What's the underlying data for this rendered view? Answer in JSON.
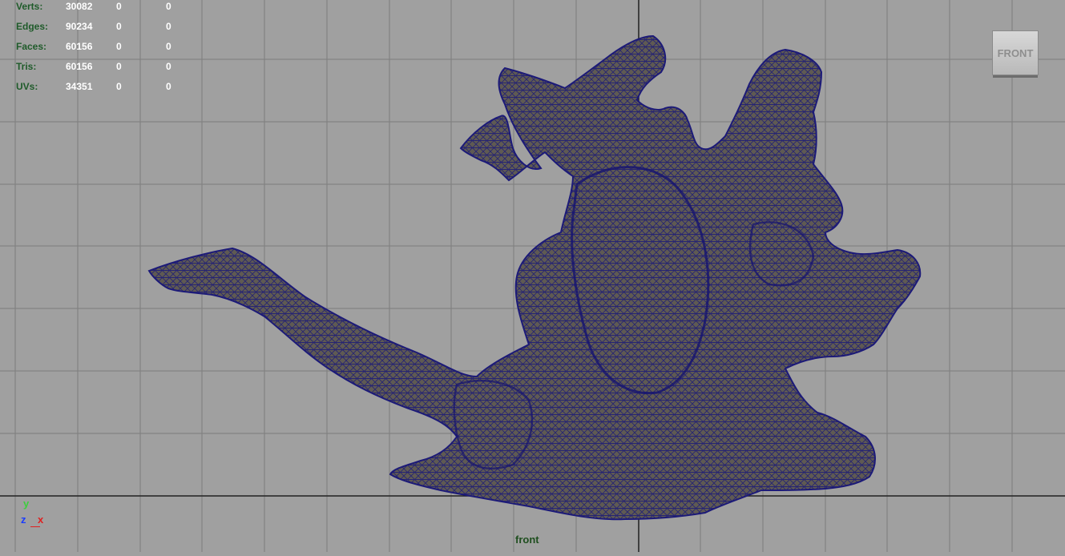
{
  "hud": {
    "rows": [
      {
        "label": "Verts:",
        "total": "30082",
        "selected": "0",
        "component": "0"
      },
      {
        "label": "Edges:",
        "total": "90234",
        "selected": "0",
        "component": "0"
      },
      {
        "label": "Faces:",
        "total": "60156",
        "selected": "0",
        "component": "0"
      },
      {
        "label": "Tris:",
        "total": "60156",
        "selected": "0",
        "component": "0"
      },
      {
        "label": "UVs:",
        "total": "34351",
        "selected": "0",
        "component": "0"
      }
    ]
  },
  "view_cube": {
    "label": "FRONT"
  },
  "camera": {
    "name": "front"
  },
  "axes": {
    "y": "y",
    "z": "z",
    "x": "x"
  },
  "colors": {
    "background": "#a0a0a0",
    "grid": "#7d7d7d",
    "axis_lines": "#202020",
    "mesh_fill": "#5f5a52",
    "wireframe": "#1c1a78",
    "hud_label": "#1f5b2a"
  },
  "icons": {
    "view_cube": "view-cube-icon",
    "axis_gizmo": "axis-gizmo-icon"
  }
}
